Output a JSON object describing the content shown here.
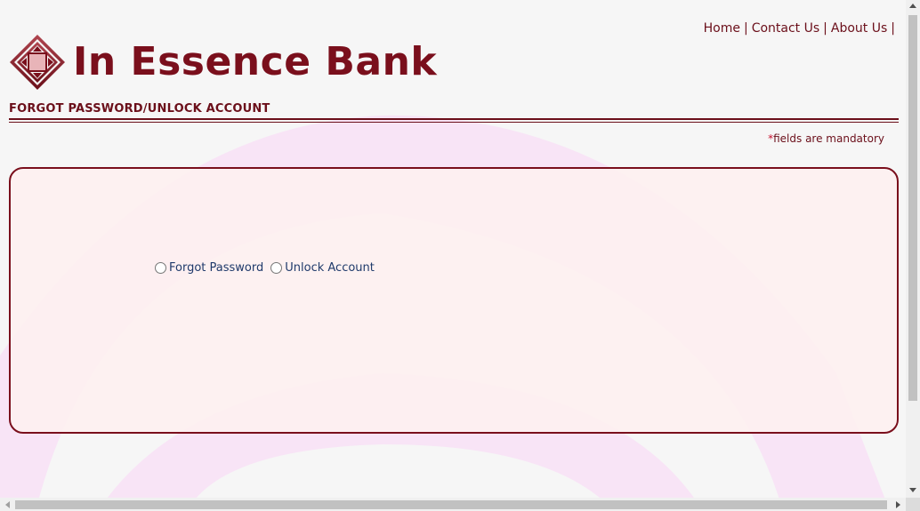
{
  "header": {
    "brand_name": "In Essence Bank",
    "nav": [
      {
        "label": "Home"
      },
      {
        "label": "Contact Us"
      },
      {
        "label": "About Us"
      }
    ],
    "separator": "|"
  },
  "section": {
    "title": "FORGOT PASSWORD/UNLOCK ACCOUNT",
    "mandatory_star": "*",
    "mandatory_text": "fields are mandatory"
  },
  "form": {
    "options": [
      {
        "label": "Forgot Password",
        "checked": false
      },
      {
        "label": "Unlock Account",
        "checked": false
      }
    ]
  },
  "colors": {
    "brand": "#7a0f1c",
    "link": "#6b0f1a",
    "option_text": "#1f3a6b",
    "panel_bg": "#fdf0f0",
    "decor_pink": "#f8e4f6"
  },
  "icons": {
    "logo": "diamond-logo-icon"
  }
}
